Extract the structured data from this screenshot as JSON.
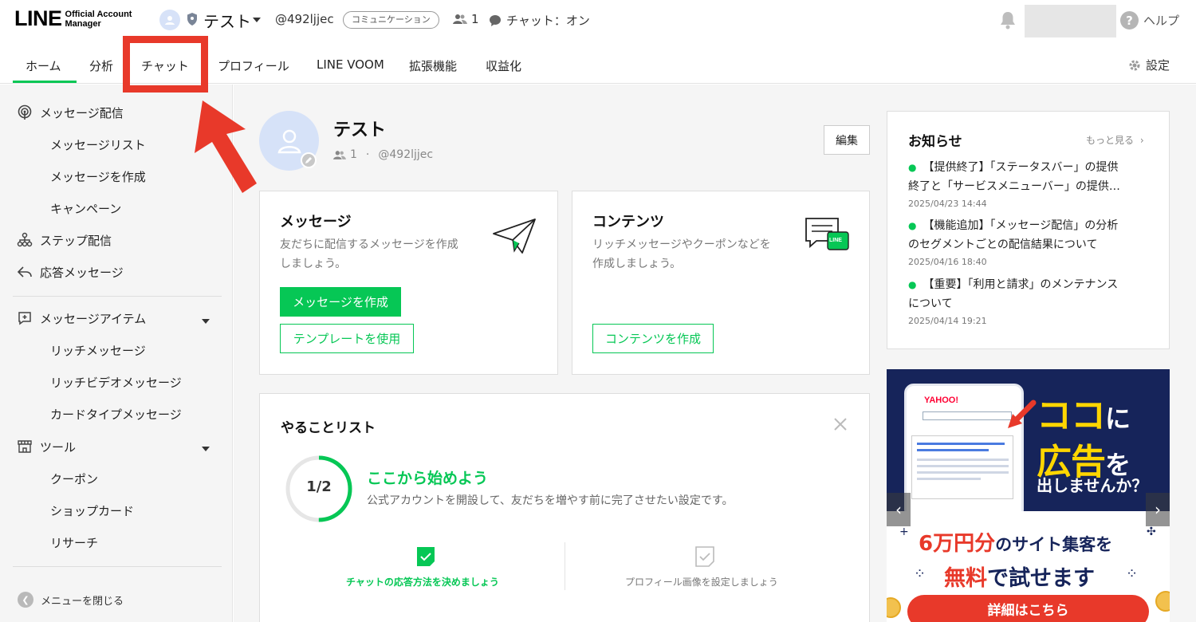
{
  "header": {
    "logo_main": "LINE",
    "logo_sub_1": "Official Account",
    "logo_sub_2": "Manager",
    "account_name": "テスト",
    "account_id": "@492ljjec",
    "account_badge": "コミュニケーション",
    "friend_count": "1",
    "chat_status": "チャット：オン",
    "help_label": "ヘルプ"
  },
  "tabs": [
    {
      "label": "ホーム",
      "active": true
    },
    {
      "label": "分析"
    },
    {
      "label": "チャット"
    },
    {
      "label": "プロフィール"
    },
    {
      "label": "LINE VOOM"
    },
    {
      "label": "拡張機能"
    },
    {
      "label": "収益化"
    }
  ],
  "settings_label": "設定",
  "sidebar": {
    "sections": [
      {
        "label": "メッセージ配信",
        "icon": "broadcast-icon",
        "children": [
          "メッセージリスト",
          "メッセージを作成",
          "キャンペーン"
        ]
      },
      {
        "label": "ステップ配信",
        "icon": "step-icon"
      },
      {
        "label": "応答メッセージ",
        "icon": "reply-icon"
      },
      {
        "label": "メッセージアイテム",
        "icon": "message-item-icon",
        "children": [
          "リッチメッセージ",
          "リッチビデオメッセージ",
          "カードタイプメッセージ"
        ]
      },
      {
        "label": "ツール",
        "icon": "shop-icon",
        "children": [
          "クーポン",
          "ショップカード",
          "リサーチ"
        ]
      }
    ],
    "collapse_label": "メニューを閉じる"
  },
  "profile": {
    "name": "テスト",
    "friends": "1",
    "separator": "·",
    "id": "@492ljjec",
    "edit_label": "編集"
  },
  "cards": {
    "message": {
      "title": "メッセージ",
      "desc_1": "友だちに配信するメッセージを作成",
      "desc_2": "しましょう。",
      "primary": "メッセージを作成",
      "secondary": "テンプレートを使用"
    },
    "content": {
      "title": "コンテンツ",
      "desc_1": "リッチメッセージやクーポンなどを",
      "desc_2": "作成しましょう。",
      "icon_badge": "LINE",
      "secondary": "コンテンツを作成"
    }
  },
  "todo": {
    "title": "やることリスト",
    "progress": "1/2",
    "progress_fraction": 0.5,
    "heading": "ここから始めよう",
    "sub": "公式アカウントを開設して、友だちを増やす前に完了させたい設定です。",
    "steps": [
      {
        "label": "チャットの応答方法を決めましょう",
        "done": true
      },
      {
        "label": "プロフィール画像を設定しましょう",
        "done": false
      }
    ]
  },
  "news": {
    "title": "お知らせ",
    "more": "もっと見る",
    "items": [
      {
        "text_1": "【提供終了】「ステータスバー」の提供",
        "text_2": "終了と「サービスメニューバー」の提供…",
        "date": "2025/04/23 14:44"
      },
      {
        "text_1": "【機能追加】「メッセージ配信」の分析",
        "text_2": "のセグメントごとの配信結果について",
        "date": "2025/04/16 18:40"
      },
      {
        "text_1": "【重要】「利用と請求」のメンテナンス",
        "text_2": "について",
        "date": "2025/04/14 19:21"
      }
    ]
  },
  "ad": {
    "yahoo": "YAHOO!",
    "coco": "ココ",
    "ni": "に",
    "koukoku": "広告",
    "wo": "を",
    "dasu": "出しませんか？",
    "man_num": "6万円分",
    "no": "の",
    "site": "サイト集客を",
    "free": "無料",
    "try": "で試せます",
    "cta": "詳細はこちら"
  },
  "colors": {
    "brand_green": "#06c755",
    "annotation_red": "#e8392a",
    "ad_navy": "#16245a"
  }
}
